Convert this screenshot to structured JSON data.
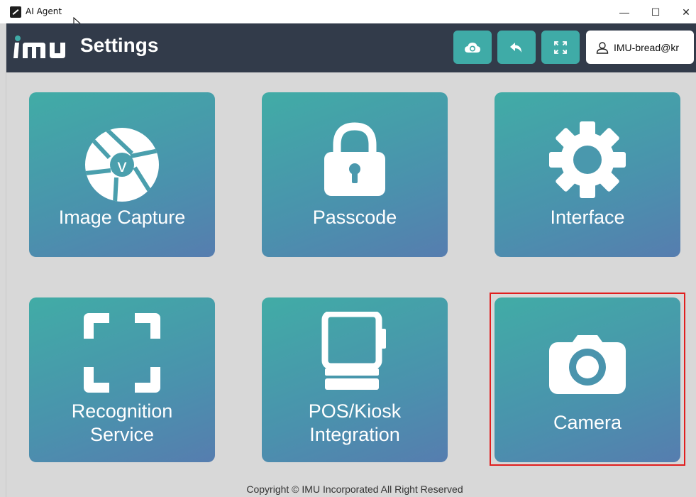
{
  "window": {
    "title": "AI Agent",
    "controls": {
      "minimize": "—",
      "maximize": "☐",
      "close": "✕"
    }
  },
  "header": {
    "logo_text": "imu",
    "title": "Settings",
    "buttons": [
      {
        "icon": "cloud-sync-icon"
      },
      {
        "icon": "reply-icon"
      },
      {
        "icon": "fullscreen-icon"
      }
    ],
    "user": {
      "icon": "user-icon",
      "name": "IMU-bread@kr"
    }
  },
  "tiles": [
    {
      "label": "Image Capture",
      "icon": "shutter-icon"
    },
    {
      "label": "Passcode",
      "icon": "lock-icon"
    },
    {
      "label": "Interface",
      "icon": "gear-icon"
    },
    {
      "label_line1": "Recognition",
      "label_line2": "Service",
      "icon": "scan-frame-icon"
    },
    {
      "label_line1": "POS/Kiosk",
      "label_line2": "Integration",
      "icon": "pos-terminal-icon"
    },
    {
      "label": "Camera",
      "icon": "camera-icon",
      "selected": true
    }
  ],
  "footer": {
    "text": "Copyright © IMU Incorporated All Right Reserved"
  },
  "colors": {
    "header_bg": "#323b4a",
    "accent": "#3faba7",
    "tile_start": "#41aca6",
    "tile_end": "#567daf",
    "selection_border": "#e01e1e"
  }
}
